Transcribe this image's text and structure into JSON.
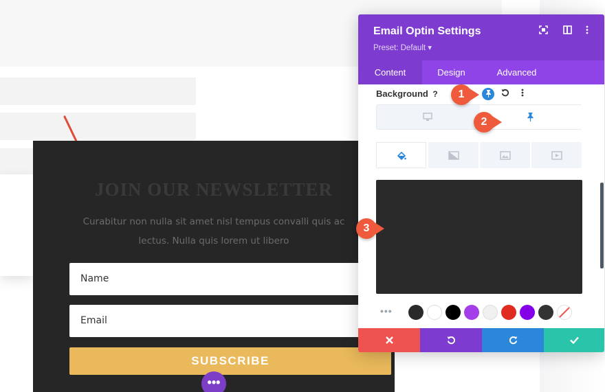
{
  "newsletter": {
    "title": "JOIN OUR NEWSLETTER",
    "description": "Curabitur non nulla sit amet nisl tempus convalli quis ac lectus. Nulla quis lorem ut libero",
    "name_placeholder": "Name",
    "email_placeholder": "Email",
    "subscribe_label": "SUBSCRIBE",
    "dots_label": "•••"
  },
  "panel": {
    "title": "Email Optin Settings",
    "preset": "Preset: Default ▾",
    "tabs": [
      {
        "label": "Content"
      },
      {
        "label": "Design"
      },
      {
        "label": "Advanced"
      }
    ],
    "active_tab": "Content",
    "background_label": "Background",
    "preview_color": "#2a2a2a",
    "swatches": [
      "#2a2a2a",
      "#ffffff",
      "#000000",
      "#a33ee8",
      "#f0f0f0",
      "#e02b20",
      "#8300e9",
      "#333333",
      "transparent"
    ],
    "swatch_more": "•••",
    "actions": {
      "cancel_color": "#ef5350",
      "undo_color": "#7e3bd0",
      "redo_color": "#2b87da",
      "save_color": "#29c4a9"
    }
  },
  "callouts": [
    "1",
    "2",
    "3"
  ],
  "colors": {
    "header": "#7e3bd0",
    "tabs": "#8e44e6",
    "accent_blue": "#2b87da",
    "subscribe": "#e9b95b",
    "callout": "#ef5a3c"
  }
}
